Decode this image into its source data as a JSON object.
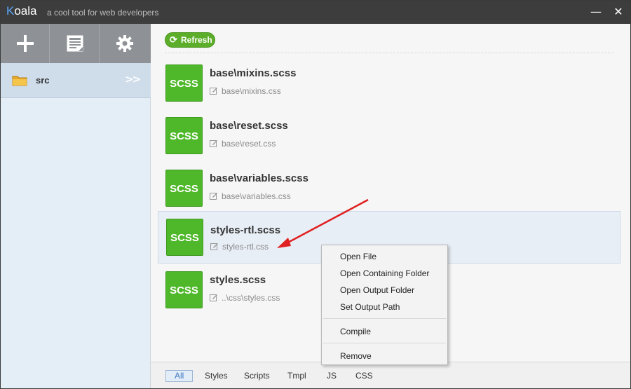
{
  "titlebar": {
    "app_name_first": "K",
    "app_name_rest": "oala",
    "subtitle": "a cool tool for web developers",
    "minimize": "—",
    "close": "✕"
  },
  "sidebar": {
    "tools": [
      {
        "name": "add-project",
        "icon": "plus-icon"
      },
      {
        "name": "log",
        "icon": "document-icon"
      },
      {
        "name": "settings",
        "icon": "gear-icon"
      }
    ],
    "projects": [
      {
        "name": "src",
        "icon": "folder-icon",
        "expand": ">>"
      }
    ]
  },
  "main": {
    "refresh_label": "Refresh",
    "files": [
      {
        "type": "SCSS",
        "name": "base\\mixins.scss",
        "output": "base\\mixins.css"
      },
      {
        "type": "SCSS",
        "name": "base\\reset.scss",
        "output": "base\\reset.css"
      },
      {
        "type": "SCSS",
        "name": "base\\variables.scss",
        "output": "base\\variables.css"
      },
      {
        "type": "SCSS",
        "name": "styles-rtl.scss",
        "output": "styles-rtl.css"
      },
      {
        "type": "SCSS",
        "name": "styles.scss",
        "output": "..\\css\\styles.css"
      }
    ],
    "selected_index": 3,
    "filters": [
      "All",
      "Styles",
      "Scripts",
      "Tmpl",
      "JS",
      "CSS"
    ],
    "active_filter": "All"
  },
  "context_menu": {
    "items": [
      "Open File",
      "Open Containing Folder",
      "Open Output Folder",
      "Set Output Path",
      "Compile",
      "Remove"
    ]
  },
  "colors": {
    "accent_green": "#4fb82a",
    "titlebar": "#3d3d3d",
    "annotation_arrow": "#e02020"
  }
}
